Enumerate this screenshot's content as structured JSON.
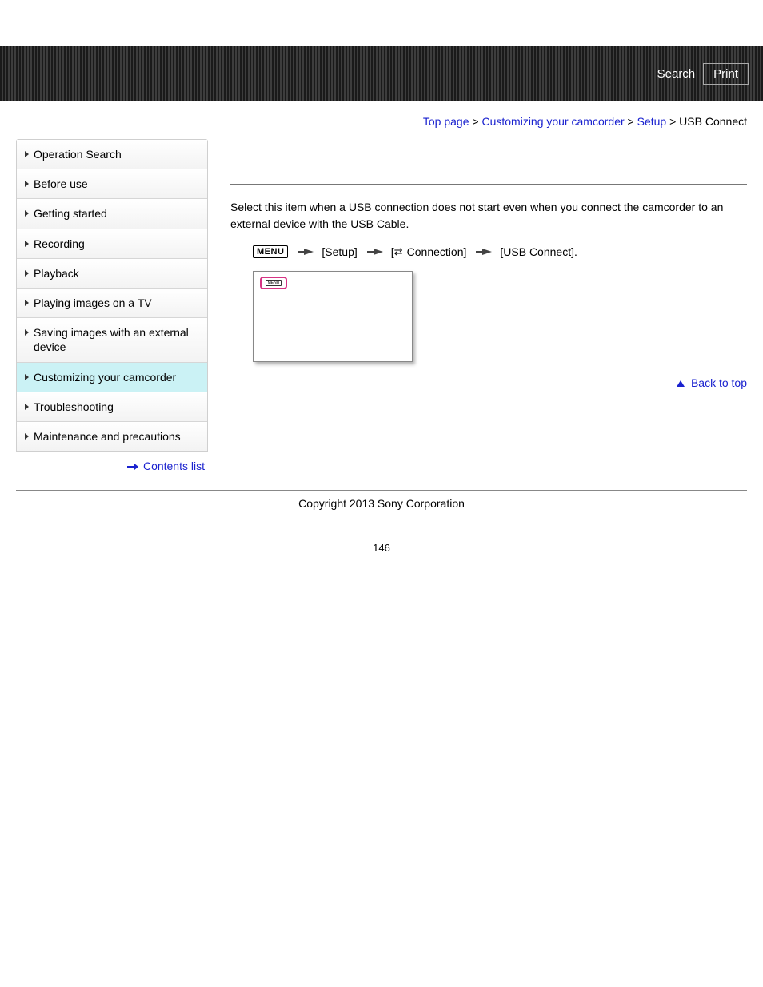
{
  "header": {
    "search": "Search",
    "print": "Print"
  },
  "breadcrumb": {
    "top": "Top page",
    "l1": "Customizing your camcorder",
    "l2": "Setup",
    "current": "USB Connect"
  },
  "sidebar": {
    "items": [
      {
        "label": "Operation Search",
        "active": false
      },
      {
        "label": "Before use",
        "active": false
      },
      {
        "label": "Getting started",
        "active": false
      },
      {
        "label": "Recording",
        "active": false
      },
      {
        "label": "Playback",
        "active": false
      },
      {
        "label": "Playing images on a TV",
        "active": false
      },
      {
        "label": "Saving images with an external device",
        "active": false
      },
      {
        "label": "Customizing your camcorder",
        "active": true
      },
      {
        "label": "Troubleshooting",
        "active": false
      },
      {
        "label": "Maintenance and precautions",
        "active": false
      }
    ],
    "contents_list": "Contents list"
  },
  "main": {
    "intro": "Select this item when a USB connection does not start even when you connect the camcorder to an external device with the USB Cable.",
    "menu_label": "MENU",
    "step1": "[Setup]",
    "step2_prefix": "[",
    "step2_text": "Connection]",
    "step3": "[USB Connect].",
    "back_to_top": "Back to top"
  },
  "footer": {
    "copyright": "Copyright 2013 Sony Corporation",
    "page_number": "146"
  }
}
